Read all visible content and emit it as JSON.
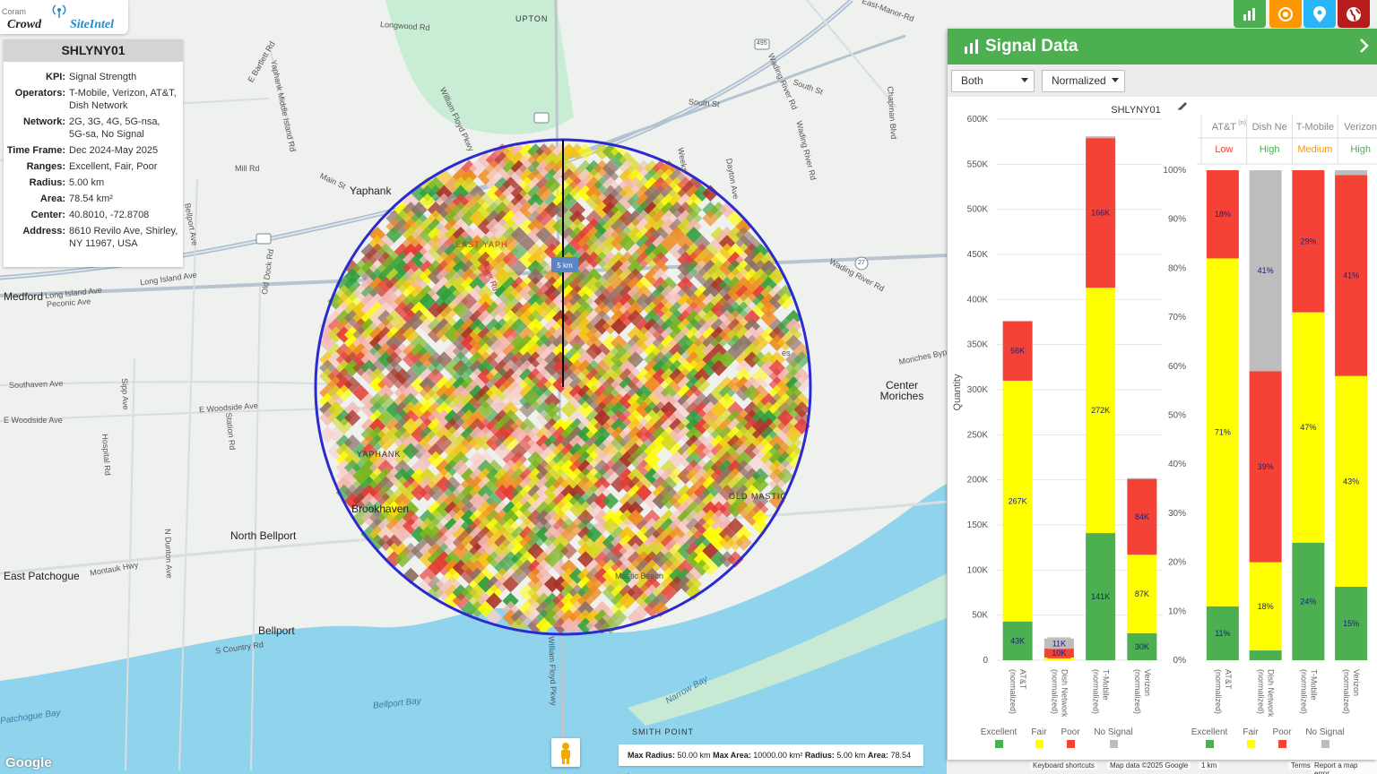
{
  "brand": {
    "corner_text": "Coram",
    "name_part1": "Crowd",
    "name_part2": "SiteIntel"
  },
  "site": {
    "id": "SHLYNY01",
    "rows": [
      {
        "k": "KPI:",
        "v": "Signal Strength"
      },
      {
        "k": "Operators:",
        "v": "T-Mobile, Verizon, AT&T, Dish Network"
      },
      {
        "k": "Network:",
        "v": "2G, 3G, 4G, 5G-nsa, 5G-sa, No Signal"
      },
      {
        "k": "Time Frame:",
        "v": "Dec 2024-May 2025"
      },
      {
        "k": "Ranges:",
        "v": "Excellent, Fair, Poor"
      },
      {
        "k": "Radius:",
        "v": "5.00 km"
      },
      {
        "k": "Area:",
        "v": "78.54 km²"
      },
      {
        "k": "Center:",
        "v": "40.8010, -72.8708"
      },
      {
        "k": "Address:",
        "v": "8610 Revilo Ave, Shirley, NY 11967, USA"
      }
    ]
  },
  "map": {
    "radius_badge": "5 km",
    "labels": {
      "upton": "UPTON",
      "yaphank": "Yaphank",
      "east_yaphank": "EAST YAPH",
      "medford": "Medford",
      "center_moriches": "Center Moriches",
      "north_bellport": "North Bellport",
      "east_patchogue": "East Patchogue",
      "bellport": "Bellport",
      "yaphank2": "YAPHANK",
      "brookhaven": "Brookhaven",
      "old_mastic": "OLD MASTIC",
      "mastic_beach": "Mastic Beach",
      "smith_point": "SMITH POINT",
      "bellport_bay": "Bellport Bay",
      "narrow_bay": "Narrow Bay",
      "patchogue_bay": "Patchogue Bay",
      "longwood_rd": "Longwood Rd",
      "south_st": "South St",
      "millrd": "Mill Rd",
      "main_st": "Main St",
      "sunrise": "Long Island Ave",
      "peconic": "Peconic Ave",
      "southaven": "Southaven Ave",
      "woodside": "E Woodside Ave",
      "woodside2": "E Woodside Ave",
      "montauk": "Montauk Hwy",
      "country": "S Country Rd",
      "wading": "Wading River Rd",
      "moriches_bypass": "Moriches Bypass",
      "east_manor": "East-Manor-Rd",
      "bartlett": "E Bartlett Rd",
      "bellport_ave": "Bellport Ave",
      "williamfloyd": "William Floyd Pkwy",
      "williamfloyd2": "William Floyd Pkwy",
      "yaphank_middle": "Yaphank Middle Island Rd",
      "old_dock": "Old Dock Rd",
      "sipp": "Sipp Ave",
      "station": "Station Rd",
      "hospital": "Hospital Rd",
      "ndunton": "N Dunton Ave",
      "chapman": "Chapman Blvd",
      "wading2": "Wading River Rd",
      "south_st2": "South St",
      "wading3": "Wading River Rd",
      "dayton": "Dayton Ave",
      "weeks": "Weeks",
      "river_rd": "River Rd",
      "rd_495": "495",
      "rd_27": "27",
      "long_island_ave2": "Long Island Ave",
      "neighborhood_es": "es"
    }
  },
  "bottom_bar": {
    "max_radius_label": "Max Radius:",
    "max_radius": "50.00 km",
    "max_area_label": "Max Area:",
    "max_area": "10000.00 km²",
    "radius_label": "Radius:",
    "radius": "5.00 km",
    "area_label": "Area:",
    "area": "78.54 km²"
  },
  "attribution": {
    "shortcuts": "Keyboard shortcuts",
    "mapdata": "Map data ©2025 Google",
    "scale": "1 km",
    "terms": "Terms",
    "report": "Report a map error",
    "google": "Google"
  },
  "panel": {
    "title": "Signal Data",
    "dropdown1": "Both",
    "dropdown2": "Normalized",
    "chart_title": "SHLYNY01",
    "y_axis_label": "Quantity",
    "rating_header_superscript": "(n)",
    "rating_headers": [
      "AT&T",
      "Dish Ne",
      "T-Mobile",
      "Verizon"
    ],
    "ratings": [
      {
        "label": "Low",
        "color": "#f44336"
      },
      {
        "label": "High",
        "color": "#4caf50"
      },
      {
        "label": "Medium",
        "color": "#ff9800"
      },
      {
        "label": "High",
        "color": "#4caf50"
      }
    ],
    "legend": [
      "Excellent",
      "Fair",
      "Poor",
      "No Signal"
    ],
    "legend2": [
      "Excellent",
      "Fair",
      "Poor",
      "No Signal"
    ]
  },
  "colors": {
    "excellent": "#4caf50",
    "fair": "#ffff00",
    "poor": "#f44336",
    "nosignal": "#bdbdbd",
    "accent": "#4caf50",
    "circle": "#2a2ad0"
  },
  "chart_data": [
    {
      "type": "bar",
      "stacked": true,
      "title": "SHLYNY01",
      "ylabel": "Quantity",
      "ylim": [
        0,
        600000
      ],
      "yticks": [
        "0",
        "50K",
        "100K",
        "150K",
        "200K",
        "250K",
        "300K",
        "350K",
        "400K",
        "450K",
        "500K",
        "550K",
        "600K"
      ],
      "categories": [
        "AT&T (normalized)",
        "Dish Network (normalized)",
        "T-Mobile (normalized)",
        "Verizon (normalized)"
      ],
      "series": [
        {
          "name": "Excellent",
          "values": [
            43000,
            0,
            141000,
            30000
          ],
          "labels": [
            "43K",
            "",
            "141K",
            "30K"
          ]
        },
        {
          "name": "Fair",
          "values": [
            267000,
            3000,
            272000,
            87000
          ],
          "labels": [
            "267K",
            "",
            "272K",
            "87K"
          ]
        },
        {
          "name": "Poor",
          "values": [
            66000,
            10000,
            166000,
            84000
          ],
          "labels": [
            "66K",
            "10K",
            "166K",
            "84K"
          ]
        },
        {
          "name": "No Signal",
          "values": [
            0,
            11000,
            2000,
            1000
          ],
          "labels": [
            "",
            "11K",
            "",
            ""
          ]
        }
      ]
    },
    {
      "type": "bar",
      "stacked": true,
      "ylim": [
        0,
        100
      ],
      "yticks": [
        "0%",
        "10%",
        "20%",
        "30%",
        "40%",
        "50%",
        "60%",
        "70%",
        "80%",
        "90%",
        "100%"
      ],
      "categories": [
        "AT&T (normalized)",
        "Dish Network (normalized)",
        "T-Mobile (normalized)",
        "Verizon (normalized)"
      ],
      "series": [
        {
          "name": "Excellent",
          "values": [
            11,
            2,
            24,
            15
          ],
          "labels": [
            "11%",
            "",
            "24%",
            "15%"
          ]
        },
        {
          "name": "Fair",
          "values": [
            71,
            18,
            47,
            43
          ],
          "labels": [
            "71%",
            "18%",
            "47%",
            "43%"
          ]
        },
        {
          "name": "Poor",
          "values": [
            18,
            39,
            29,
            41
          ],
          "labels": [
            "18%",
            "39%",
            "29%",
            "41%"
          ]
        },
        {
          "name": "No Signal",
          "values": [
            0,
            41,
            0,
            1
          ],
          "labels": [
            "",
            "41%",
            "",
            ""
          ]
        }
      ]
    }
  ]
}
